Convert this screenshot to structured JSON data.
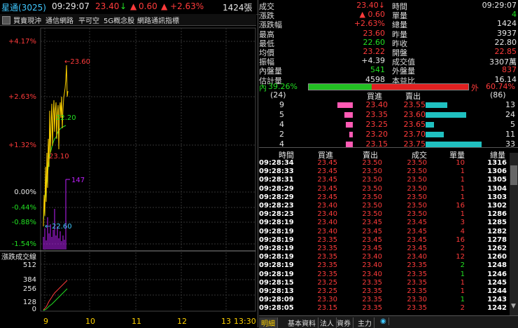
{
  "header": {
    "stock": "星通(3025)",
    "time": "09:29:07",
    "price": "23.40",
    "price_arrow": "↓",
    "change_arrow": "▲",
    "change": "0.60",
    "change_pct_arrow": "▲",
    "change_pct": "+2.63%",
    "volume": "1424張"
  },
  "toolbar": {
    "items": [
      "買賣現沖",
      "通信網路",
      "平可空",
      "5G概念股",
      "網路通訊指標"
    ]
  },
  "chart": {
    "price_ticks": [
      "+4.17%",
      "+2.63%",
      "+1.32%",
      "0.00%",
      "-0.44%",
      "-0.88%",
      "-1.54%"
    ],
    "vol_title": "漲跌成交線",
    "vol_ticks": [
      "512",
      "384",
      "256",
      "128",
      "0"
    ],
    "x_ticks": [
      "9",
      "10",
      "11",
      "12",
      "13",
      "13:30"
    ],
    "annotations": {
      "high": "←23.60",
      "mid": "22.20",
      "low": "23.10",
      "vol": "147",
      "prev": "22.60"
    }
  },
  "chart_data": {
    "type": "line",
    "price_axis_pct": [
      4.17,
      2.63,
      1.32,
      0.0,
      -0.44,
      -0.88,
      -1.54
    ],
    "vol_axis": [
      512,
      384,
      256,
      128,
      0
    ],
    "x": [
      "9",
      "10",
      "11",
      "12",
      "13",
      "13:30"
    ],
    "high": 23.6,
    "low": 22.6
  },
  "quote": {
    "left": [
      {
        "label": "成交",
        "value": "23.40↓",
        "color": "#ff3b3b"
      },
      {
        "label": "漲跌",
        "value": "▲ 0.60",
        "color": "#ff3b3b"
      },
      {
        "label": "漲跌幅",
        "value": "+2.63%",
        "color": "#ff3b3b"
      },
      {
        "label": "最高",
        "value": "23.60",
        "color": "#ff3b3b"
      },
      {
        "label": "最低",
        "value": "22.60",
        "color": "#22e022"
      },
      {
        "label": "均價",
        "value": "23.22",
        "color": "#ff3b3b"
      },
      {
        "label": "振幅",
        "value": "+4.39",
        "color": "#e8e8e8"
      },
      {
        "label": "內盤量",
        "value": "541",
        "color": "#22e022"
      },
      {
        "label": "估計量",
        "value": "4598",
        "color": "#e8e8e8"
      }
    ],
    "right": [
      {
        "label": "時間",
        "value": "09:29:07",
        "color": "#e8e8e8"
      },
      {
        "label": "單量",
        "value": "4",
        "color": "#22e022"
      },
      {
        "label": "總量",
        "value": "1424",
        "color": "#e8e8e8"
      },
      {
        "label": "昨量",
        "value": "3937",
        "color": "#e8e8e8"
      },
      {
        "label": "昨收",
        "value": "22.80",
        "color": "#e8e8e8"
      },
      {
        "label": "開盤",
        "value": "22.85",
        "color": "#ff3b3b"
      },
      {
        "label": "成交值",
        "value": "3307萬",
        "color": "#e8e8e8"
      },
      {
        "label": "外盤量",
        "value": "837",
        "color": "#ff3b3b"
      },
      {
        "label": "本益比",
        "value": "16.14",
        "color": "#e8e8e8"
      }
    ],
    "inner_label": "內",
    "inner_pct": "39.26%",
    "outer_label": "外",
    "outer_pct": "60.74%",
    "inner_ratio": 0.3926
  },
  "book": {
    "left_count": "(24)",
    "right_count": "(86)",
    "bid_header": "買進",
    "ask_header": "賣出",
    "rows": [
      {
        "bid_qty": "9",
        "bid": "23.40",
        "ask": "23.55",
        "ask_qty": "13",
        "bid_bar": 0.27,
        "ask_bar": 0.39
      },
      {
        "bid_qty": "5",
        "bid": "23.35",
        "ask": "23.60",
        "ask_qty": "24",
        "bid_bar": 0.15,
        "ask_bar": 0.73
      },
      {
        "bid_qty": "4",
        "bid": "23.25",
        "ask": "23.65",
        "ask_qty": "5",
        "bid_bar": 0.12,
        "ask_bar": 0.15
      },
      {
        "bid_qty": "2",
        "bid": "23.20",
        "ask": "23.70",
        "ask_qty": "11",
        "bid_bar": 0.06,
        "ask_bar": 0.33
      },
      {
        "bid_qty": "4",
        "bid": "23.15",
        "ask": "23.75",
        "ask_qty": "33",
        "bid_bar": 0.12,
        "ask_bar": 1.0
      }
    ]
  },
  "ticks": {
    "headers": [
      "時間",
      "買進",
      "賣出",
      "成交",
      "單量",
      "總量"
    ],
    "rows": [
      {
        "t": "09:28:34",
        "b": "23.45",
        "s": "23.50",
        "p": "23.50",
        "q": "10",
        "qc": "#ff3b3b",
        "v": "1316"
      },
      {
        "t": "09:28:33",
        "b": "23.45",
        "s": "23.50",
        "p": "23.50",
        "q": "1",
        "qc": "#ff3b3b",
        "v": "1306"
      },
      {
        "t": "09:28:31",
        "b": "23.45",
        "s": "23.50",
        "p": "23.50",
        "q": "1",
        "qc": "#ff3b3b",
        "v": "1305"
      },
      {
        "t": "09:28:29",
        "b": "23.45",
        "s": "23.50",
        "p": "23.50",
        "q": "1",
        "qc": "#ff3b3b",
        "v": "1304"
      },
      {
        "t": "09:28:29",
        "b": "23.45",
        "s": "23.50",
        "p": "23.50",
        "q": "1",
        "qc": "#ff3b3b",
        "v": "1303"
      },
      {
        "t": "09:28:23",
        "b": "23.40",
        "s": "23.50",
        "p": "23.50",
        "q": "16",
        "qc": "#ff3b3b",
        "v": "1302"
      },
      {
        "t": "09:28:23",
        "b": "23.40",
        "s": "23.50",
        "p": "23.50",
        "q": "1",
        "qc": "#ff3b3b",
        "v": "1286"
      },
      {
        "t": "09:28:19",
        "b": "23.40",
        "s": "23.45",
        "p": "23.45",
        "q": "3",
        "qc": "#ff3b3b",
        "v": "1285"
      },
      {
        "t": "09:28:19",
        "b": "23.40",
        "s": "23.45",
        "p": "23.45",
        "q": "4",
        "qc": "#ff3b3b",
        "v": "1282"
      },
      {
        "t": "09:28:19",
        "b": "23.35",
        "s": "23.45",
        "p": "23.45",
        "q": "16",
        "qc": "#ff3b3b",
        "v": "1278"
      },
      {
        "t": "09:28:19",
        "b": "23.35",
        "s": "23.45",
        "p": "23.45",
        "q": "2",
        "qc": "#ff3b3b",
        "v": "1262"
      },
      {
        "t": "09:28:19",
        "b": "23.35",
        "s": "23.40",
        "p": "23.40",
        "q": "12",
        "qc": "#ff3b3b",
        "v": "1260"
      },
      {
        "t": "09:28:19",
        "b": "23.35",
        "s": "23.40",
        "p": "23.35",
        "q": "2",
        "qc": "#22e022",
        "v": "1248"
      },
      {
        "t": "09:28:19",
        "b": "23.35",
        "s": "23.40",
        "p": "23.35",
        "q": "1",
        "qc": "#22e022",
        "v": "1246"
      },
      {
        "t": "09:28:15",
        "b": "23.25",
        "s": "23.35",
        "p": "23.35",
        "q": "1",
        "qc": "#ff3b3b",
        "v": "1245"
      },
      {
        "t": "09:28:13",
        "b": "23.25",
        "s": "23.35",
        "p": "23.35",
        "q": "1",
        "qc": "#ff3b3b",
        "v": "1244"
      },
      {
        "t": "09:28:09",
        "b": "23.30",
        "s": "23.35",
        "p": "23.30",
        "q": "1",
        "qc": "#22e022",
        "v": "1243"
      },
      {
        "t": "09:28:05",
        "b": "23.15",
        "s": "23.35",
        "p": "23.35",
        "q": "2",
        "qc": "#ff3b3b",
        "v": "1242"
      }
    ]
  },
  "tabs": [
    "明細",
    "基本資料",
    "法人",
    "資券",
    "主力"
  ]
}
